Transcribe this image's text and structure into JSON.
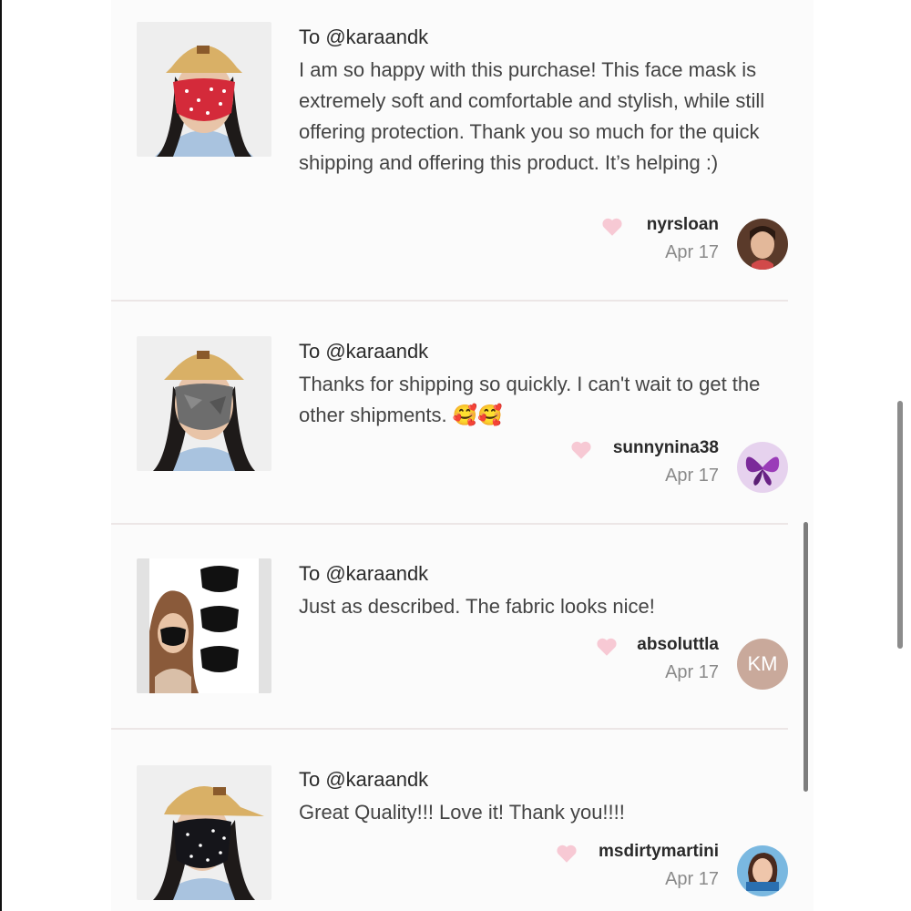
{
  "reviews": [
    {
      "to": "To @karaandk",
      "text": "I am so happy with this purchase! This face mask is extremely soft and comfortable and stylish, while still offering protection. Thank you so much for the quick shipping and offering this product. It’s helping :)",
      "username": "nyrsloan",
      "date": "Apr 17"
    },
    {
      "to": "To @karaandk",
      "text": "Thanks for shipping so quickly. I can't wait to get the other shipments. 🥰🥰",
      "username": "sunnynina38",
      "date": "Apr 17"
    },
    {
      "to": "To @karaandk",
      "text": "Just as described. The fabric looks nice!",
      "username": "absoluttla",
      "date": "Apr 17",
      "avatar_initials": "KM"
    },
    {
      "to": "To @karaandk",
      "text": "Great Quality!!! Love it! Thank you!!!!",
      "username": "msdirtymartini",
      "date": "Apr 17"
    }
  ],
  "colors": {
    "heart": "#f7c9d4",
    "avatar_km": "#c9a99b"
  }
}
